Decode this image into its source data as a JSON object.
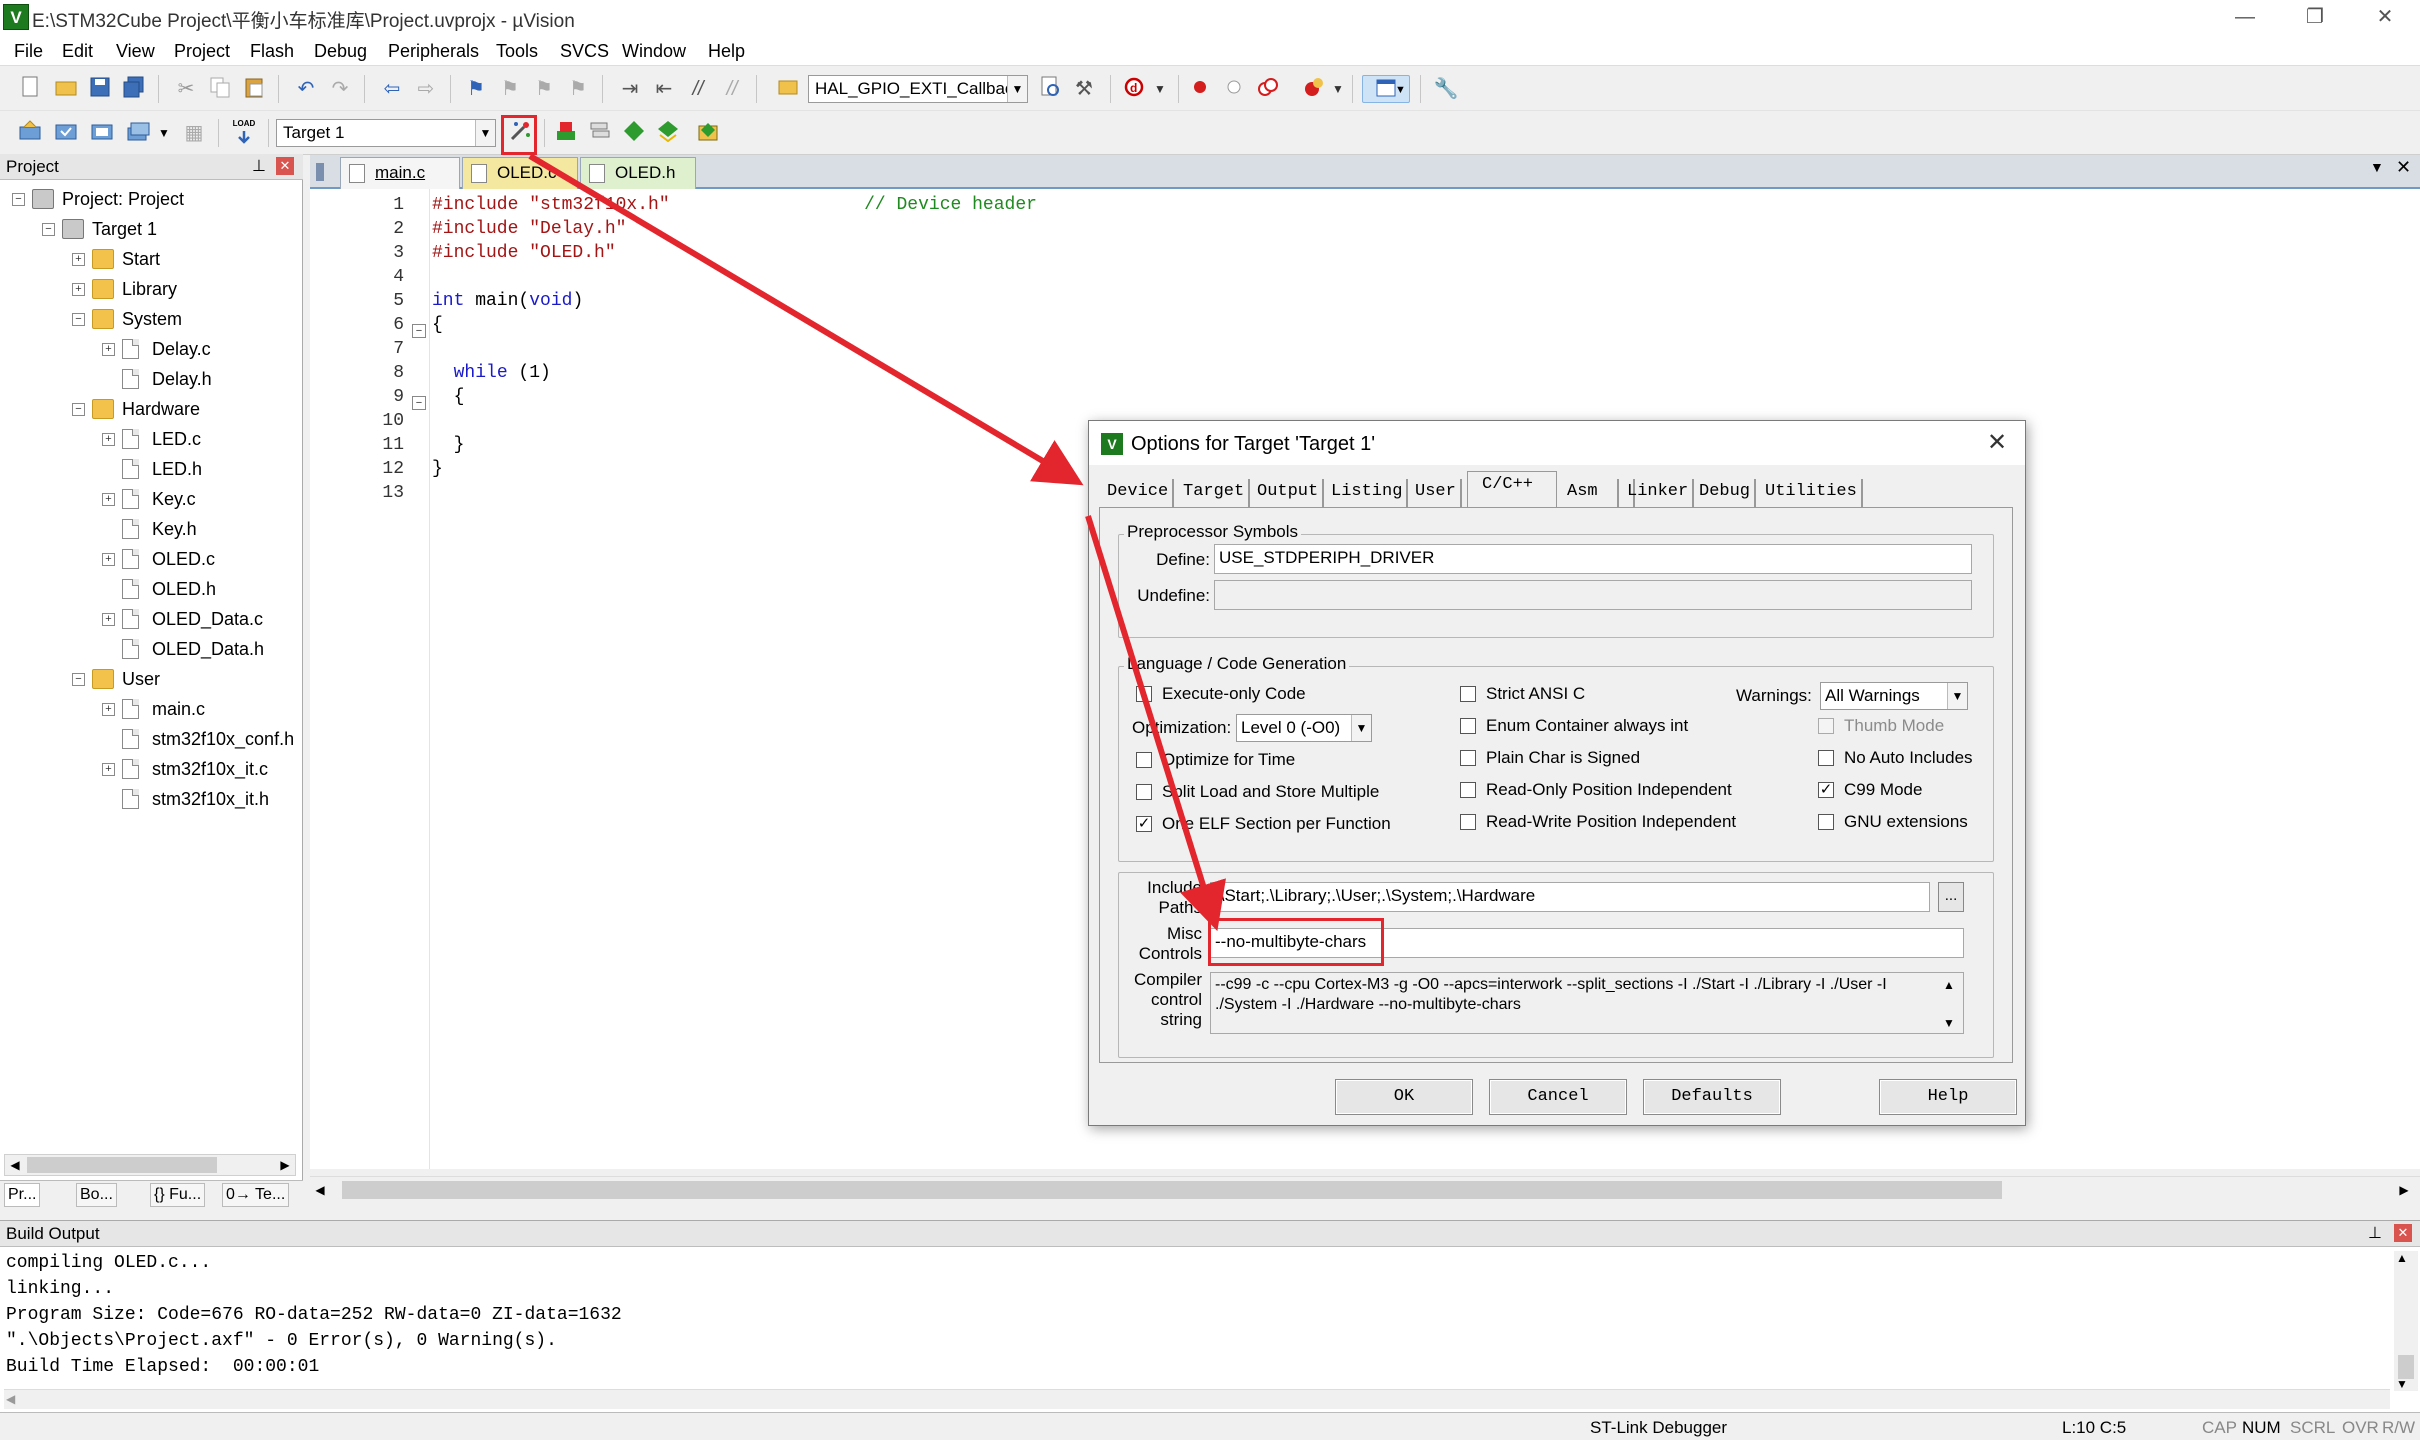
{
  "window": {
    "title": "E:\\STM32Cube Project\\平衡小车标准库\\Project.uvprojx - µVision",
    "app_icon": "V",
    "minimize": "—",
    "restore": "❐",
    "close": "✕"
  },
  "menu": [
    "File",
    "Edit",
    "View",
    "Project",
    "Flash",
    "Debug",
    "Peripherals",
    "Tools",
    "SVCS",
    "Window",
    "Help"
  ],
  "toolbar": {
    "find_combo_value": "HAL_GPIO_EXTI_Callback",
    "target_combo_value": "Target 1",
    "load_label": "LOAD"
  },
  "project_panel": {
    "title": "Project",
    "pin": "⊥",
    "close": "✕",
    "tree": [
      {
        "label": "Project: Project",
        "level": 0,
        "type": "project",
        "expander": "minus"
      },
      {
        "label": "Target 1",
        "level": 1,
        "type": "target",
        "expander": "minus"
      },
      {
        "label": "Start",
        "level": 2,
        "type": "folder",
        "expander": "plus"
      },
      {
        "label": "Library",
        "level": 2,
        "type": "folder",
        "expander": "plus"
      },
      {
        "label": "System",
        "level": 2,
        "type": "folder",
        "expander": "minus"
      },
      {
        "label": "Delay.c",
        "level": 3,
        "type": "file",
        "expander": "plus"
      },
      {
        "label": "Delay.h",
        "level": 3,
        "type": "file",
        "expander": "none"
      },
      {
        "label": "Hardware",
        "level": 2,
        "type": "folder",
        "expander": "minus"
      },
      {
        "label": "LED.c",
        "level": 3,
        "type": "file",
        "expander": "plus"
      },
      {
        "label": "LED.h",
        "level": 3,
        "type": "file",
        "expander": "none"
      },
      {
        "label": "Key.c",
        "level": 3,
        "type": "file",
        "expander": "plus"
      },
      {
        "label": "Key.h",
        "level": 3,
        "type": "file",
        "expander": "none"
      },
      {
        "label": "OLED.c",
        "level": 3,
        "type": "file",
        "expander": "plus"
      },
      {
        "label": "OLED.h",
        "level": 3,
        "type": "file",
        "expander": "none"
      },
      {
        "label": "OLED_Data.c",
        "level": 3,
        "type": "file",
        "expander": "plus"
      },
      {
        "label": "OLED_Data.h",
        "level": 3,
        "type": "file",
        "expander": "none"
      },
      {
        "label": "User",
        "level": 2,
        "type": "folder",
        "expander": "minus"
      },
      {
        "label": "main.c",
        "level": 3,
        "type": "file",
        "expander": "plus"
      },
      {
        "label": "stm32f10x_conf.h",
        "level": 3,
        "type": "file",
        "expander": "none"
      },
      {
        "label": "stm32f10x_it.c",
        "level": 3,
        "type": "file",
        "expander": "plus"
      },
      {
        "label": "stm32f10x_it.h",
        "level": 3,
        "type": "file",
        "expander": "none"
      }
    ],
    "tabs": [
      "Pr...",
      "Bo...",
      "{} Fu...",
      "0→ Te..."
    ]
  },
  "editor": {
    "tabs": [
      {
        "label": "main.c",
        "active": true,
        "color": "#f5f5f5"
      },
      {
        "label": "OLED.c",
        "active": false,
        "color": "#f4e8a1"
      },
      {
        "label": "OLED.h",
        "active": false,
        "color": "#dff0cf"
      }
    ],
    "lines": [
      {
        "n": "1",
        "parts": [
          [
            "pp",
            "#include "
          ],
          [
            "str",
            "\"stm32f10x.h\""
          ],
          [
            "",
            "                  "
          ],
          [
            "cm",
            "// Device header"
          ]
        ]
      },
      {
        "n": "2",
        "parts": [
          [
            "pp",
            "#include "
          ],
          [
            "str",
            "\"Delay.h\""
          ]
        ]
      },
      {
        "n": "3",
        "parts": [
          [
            "pp",
            "#include "
          ],
          [
            "str",
            "\"OLED.h\""
          ]
        ]
      },
      {
        "n": "4",
        "parts": []
      },
      {
        "n": "5",
        "parts": [
          [
            "kw",
            "int"
          ],
          [
            "",
            " main("
          ],
          [
            "kw",
            "void"
          ],
          [
            "",
            ")"
          ]
        ]
      },
      {
        "n": "6",
        "parts": [
          [
            "",
            "{"
          ]
        ],
        "fold": "⊟"
      },
      {
        "n": "7",
        "parts": []
      },
      {
        "n": "8",
        "parts": [
          [
            "",
            "  "
          ],
          [
            "kw",
            "while"
          ],
          [
            "",
            " (1)"
          ]
        ]
      },
      {
        "n": "9",
        "parts": [
          [
            "",
            "  {"
          ]
        ],
        "fold": "⊟"
      },
      {
        "n": "10",
        "parts": []
      },
      {
        "n": "11",
        "parts": [
          [
            "",
            "  }"
          ]
        ]
      },
      {
        "n": "12",
        "parts": [
          [
            "",
            "}"
          ]
        ]
      },
      {
        "n": "13",
        "parts": []
      }
    ]
  },
  "dialog": {
    "title": "Options for Target 'Target 1'",
    "close": "✕",
    "tabs": [
      "Device",
      "Target",
      "Output",
      "Listing",
      "User",
      "C/C++",
      "Asm",
      "Linker",
      "Debug",
      "Utilities"
    ],
    "active_tab": "C/C++",
    "preprocessor": {
      "group_title": "Preprocessor Symbols",
      "define_label": "Define:",
      "define_value": "USE_STDPERIPH_DRIVER",
      "undefine_label": "Undefine:",
      "undefine_value": ""
    },
    "language": {
      "group_title": "Language / Code Generation",
      "left_options": [
        {
          "label": "Execute-only Code",
          "checked": false
        },
        {
          "label": "Optimize for Time",
          "checked": false
        },
        {
          "label": "Split Load and Store Multiple",
          "checked": false
        },
        {
          "label": "One ELF Section per Function",
          "checked": true
        }
      ],
      "optimization_label": "Optimization:",
      "optimization_value": "Level 0 (-O0)",
      "mid_options": [
        {
          "label": "Strict ANSI C",
          "checked": false
        },
        {
          "label": "Enum Container always int",
          "checked": false
        },
        {
          "label": "Plain Char is Signed",
          "checked": false
        },
        {
          "label": "Read-Only Position Independent",
          "checked": false
        },
        {
          "label": "Read-Write Position Independent",
          "checked": false
        }
      ],
      "warnings_label": "Warnings:",
      "warnings_value": "All Warnings",
      "right_options": [
        {
          "label": "Thumb Mode",
          "checked": false,
          "disabled": true
        },
        {
          "label": "No Auto Includes",
          "checked": false,
          "disabled": false
        },
        {
          "label": "C99 Mode",
          "checked": true,
          "disabled": false
        },
        {
          "label": "GNU extensions",
          "checked": false,
          "disabled": false
        }
      ]
    },
    "include_paths_label": "Include\nPaths",
    "include_paths_value": ".\\Start;.\\Library;.\\User;.\\System;.\\Hardware",
    "include_browse": "...",
    "misc_controls_label": "Misc\nControls",
    "misc_controls_value": "--no-multibyte-chars",
    "compiler_string_label": "Compiler\ncontrol\nstring",
    "compiler_string_line1": "--c99 -c --cpu Cortex-M3 -g -O0 --apcs=interwork --split_sections -I ./Start -I ./Library -I ./User -I",
    "compiler_string_line2": "./System -I ./Hardware --no-multibyte-chars",
    "buttons": {
      "ok": "OK",
      "cancel": "Cancel",
      "defaults": "Defaults",
      "help": "Help"
    }
  },
  "build_output": {
    "title": "Build Output",
    "lines": [
      "compiling OLED.c...",
      "linking...",
      "Program Size: Code=676 RO-data=252 RW-data=0 ZI-data=1632",
      "\".\\Objects\\Project.axf\" - 0 Error(s), 0 Warning(s).",
      "Build Time Elapsed:  00:00:01"
    ]
  },
  "status_bar": {
    "debugger": "ST-Link Debugger",
    "cursor": "L:10 C:5",
    "indicators": [
      "CAP",
      "NUM",
      "SCRL",
      "OVR",
      "R/W"
    ]
  },
  "colors": {
    "highlight": "#e3262d",
    "keyword": "#1a1ac8",
    "string": "#a31515",
    "comment": "#1f8a1f"
  }
}
